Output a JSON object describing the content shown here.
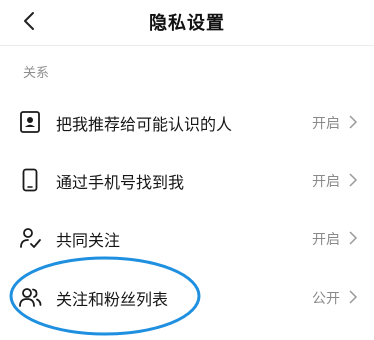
{
  "header": {
    "title": "隐私设置",
    "back_icon": "chevron-left-icon"
  },
  "section": {
    "label": "关系"
  },
  "rows": [
    {
      "label": "把我推荐给可能认识的人",
      "status": "开启",
      "icon": "contact-card-icon"
    },
    {
      "label": "通过手机号找到我",
      "status": "开启",
      "icon": "phone-icon"
    },
    {
      "label": "共同关注",
      "status": "开启",
      "icon": "user-check-icon"
    },
    {
      "label": "关注和粉丝列表",
      "status": "公开",
      "icon": "users-icon"
    }
  ],
  "colors": {
    "annotation": "#1f8fe0",
    "muted": "#8a8a8a",
    "text": "#161616"
  }
}
